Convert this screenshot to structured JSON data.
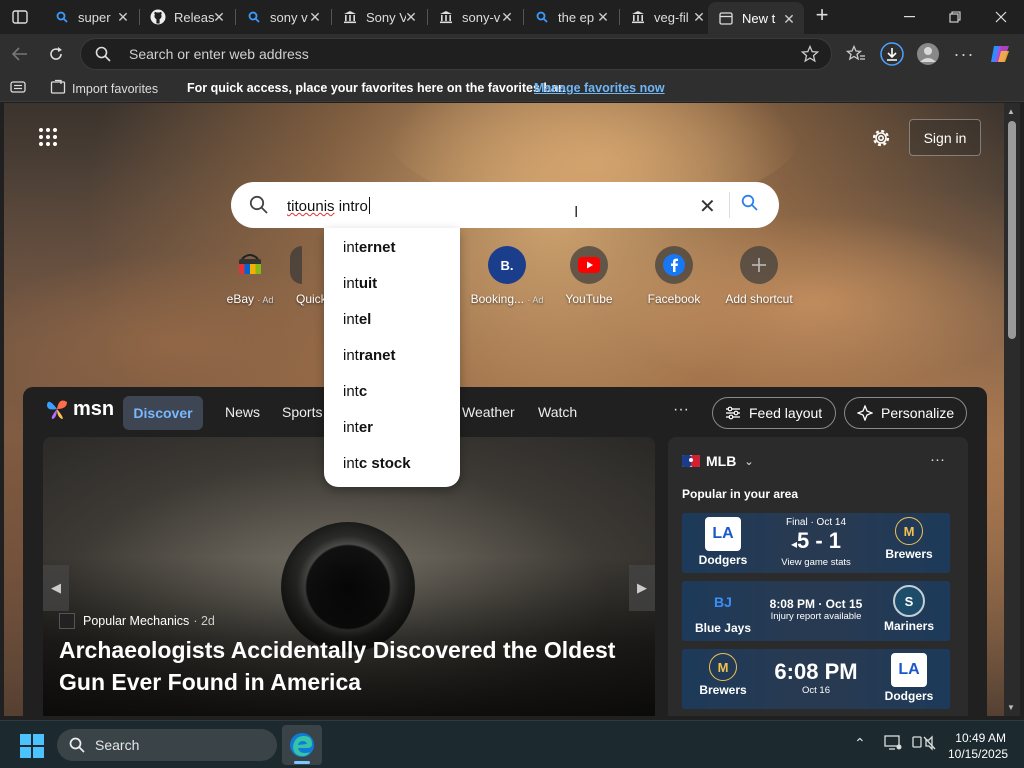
{
  "tabs": [
    {
      "title": "super",
      "icon": "bing-search-icon"
    },
    {
      "title": "Releas",
      "icon": "github-icon"
    },
    {
      "title": "sony v",
      "icon": "bing-search-icon"
    },
    {
      "title": "Sony V",
      "icon": "museum-icon"
    },
    {
      "title": "sony-v",
      "icon": "museum-icon"
    },
    {
      "title": "the ep",
      "icon": "bing-search-icon"
    },
    {
      "title": "veg-fil",
      "icon": "museum-icon"
    },
    {
      "title": "New t",
      "icon": "newtab-icon",
      "active": true
    }
  ],
  "toolbar": {
    "address_placeholder": "Search or enter web address"
  },
  "favbar": {
    "import_label": "Import favorites",
    "hint": "For quick access, place your favorites here on the favorites bar.",
    "manage_link": "Manage favorites now"
  },
  "ntp": {
    "signin_label": "Sign in",
    "search": {
      "query_misspelled": "titounis",
      "query_rest": " intro"
    },
    "suggestions": [
      {
        "prefix": "int",
        "rest": "ernet"
      },
      {
        "prefix": "int",
        "rest": "uit"
      },
      {
        "prefix": "int",
        "rest": "el"
      },
      {
        "prefix": "int",
        "rest": "ranet"
      },
      {
        "prefix": "int",
        "rest": "c"
      },
      {
        "prefix": "int",
        "rest": "er"
      },
      {
        "prefix": "int",
        "rest": "c stock"
      }
    ],
    "shortcuts": [
      {
        "label": "eBay",
        "ad": "· Ad",
        "icon": "ebay-icon"
      },
      {
        "label": "Quick",
        "ad": "",
        "icon": "quick-links-icon"
      },
      {
        "label": "Booking...",
        "ad": "· Ad",
        "icon": "booking-icon"
      },
      {
        "label": "YouTube",
        "ad": "",
        "icon": "youtube-icon"
      },
      {
        "label": "Facebook",
        "ad": "",
        "icon": "facebook-icon"
      },
      {
        "label": "Add shortcut",
        "ad": "",
        "icon": "plus-icon"
      }
    ]
  },
  "feed": {
    "brand": "msn",
    "nav": [
      "Discover",
      "News",
      "Sports",
      "Weather",
      "Watch"
    ],
    "more": "···",
    "feed_layout": "Feed layout",
    "personalize": "Personalize",
    "hero": {
      "source": "Popular Mechanics",
      "age": "· 2d",
      "headline": "Archaeologists Accidentally Discovered the Oldest Gun Ever Found in America"
    },
    "mlb": {
      "title": "MLB",
      "subtitle": "Popular in your area",
      "more": "···",
      "games": [
        {
          "home": "Dodgers",
          "home_logo": "LA",
          "away": "Brewers",
          "away_logo": "M",
          "line1": "Final · Oct 14",
          "center": "5 - 1",
          "line2": "View game stats"
        },
        {
          "home": "Blue Jays",
          "home_logo": "BJ",
          "away": "Mariners",
          "away_logo": "S",
          "line1": "8:08 PM · Oct 15",
          "center": "",
          "line2": "Injury report available"
        },
        {
          "home": "Brewers",
          "home_logo": "M",
          "away": "Dodgers",
          "away_logo": "LA",
          "line1": "",
          "center": "6:08 PM",
          "line2": "Oct 16"
        }
      ]
    }
  },
  "taskbar": {
    "search_label": "Search",
    "time": "10:49 AM",
    "date": "10/15/2025"
  },
  "colors": {
    "accent_link": "#6fb6f6",
    "msn_active": "#79b8ff",
    "ebay_red": "#e53238",
    "youtube_red": "#ff0000",
    "facebook_blue": "#1877f2",
    "booking_blue": "#1a3e8c"
  }
}
